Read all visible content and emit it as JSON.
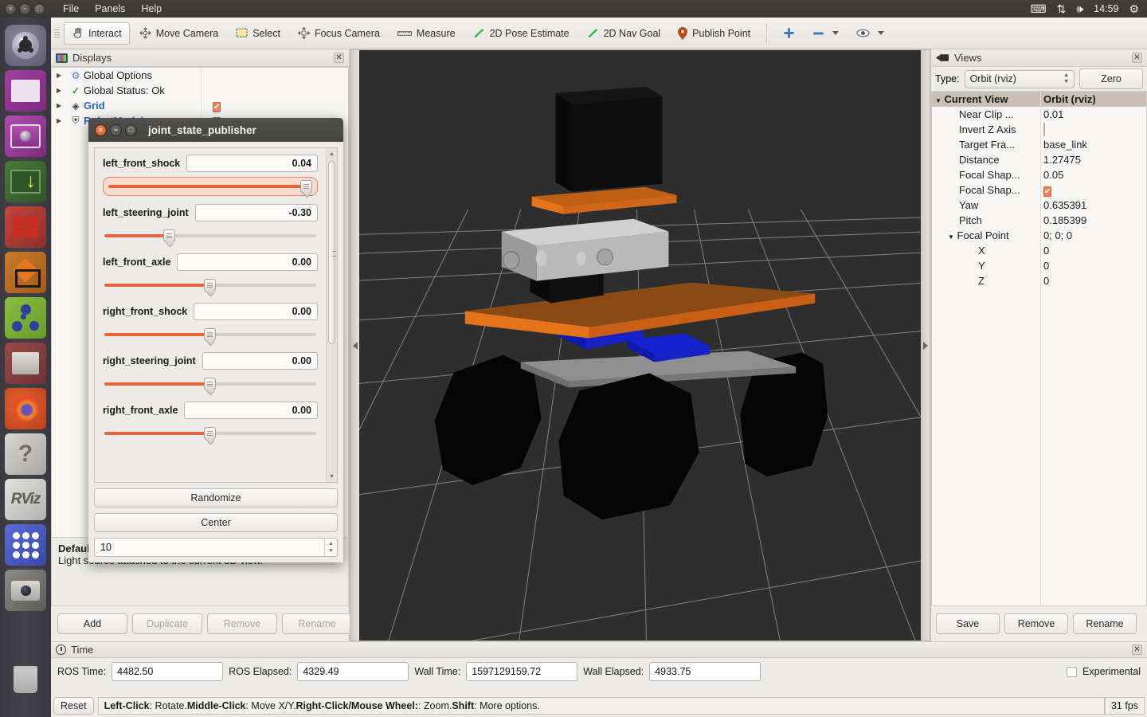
{
  "desktop": {
    "menu": [
      "File",
      "Panels",
      "Help"
    ],
    "window_buttons": [
      "close",
      "minimize",
      "maximize"
    ],
    "tray": {
      "icons": [
        "keyboard-icon",
        "network-updown-icon",
        "volume-icon",
        "power-gear-icon"
      ],
      "clock": "14:59"
    }
  },
  "launcher": {
    "items": [
      {
        "name": "ubuntu-dash",
        "label": "Ubuntu"
      },
      {
        "name": "files",
        "label": "Files"
      },
      {
        "name": "amplifier",
        "label": "Amplifier"
      },
      {
        "name": "terminator",
        "label": "Terminator"
      },
      {
        "name": "red-app",
        "label": "Red App"
      },
      {
        "name": "gazebo",
        "label": "Gazebo"
      },
      {
        "name": "rqt-graph",
        "label": "rqt graph"
      },
      {
        "name": "file-cabinet",
        "label": "File Cabinet"
      },
      {
        "name": "firefox",
        "label": "Firefox"
      },
      {
        "name": "help",
        "label": "Help"
      },
      {
        "name": "rviz",
        "label": "RViz"
      },
      {
        "name": "show-applications",
        "label": "Show Applications"
      },
      {
        "name": "camera",
        "label": "Camera"
      },
      {
        "name": "trash",
        "label": "Trash"
      }
    ]
  },
  "toolbar": {
    "tools": [
      {
        "label": "Interact",
        "icon": "hand-cursor-icon",
        "active": true
      },
      {
        "label": "Move Camera",
        "icon": "move-camera-icon",
        "active": false
      },
      {
        "label": "Select",
        "icon": "select-rect-icon",
        "active": false
      },
      {
        "label": "Focus Camera",
        "icon": "focus-camera-icon",
        "active": false
      },
      {
        "label": "Measure",
        "icon": "ruler-icon",
        "active": false
      },
      {
        "label": "2D Pose Estimate",
        "icon": "pose-arrow-icon",
        "active": false
      },
      {
        "label": "2D Nav Goal",
        "icon": "nav-goal-arrow-icon",
        "active": false
      },
      {
        "label": "Publish Point",
        "icon": "map-pin-icon",
        "active": false
      }
    ],
    "extra_icons": [
      "plus-icon",
      "minus-icon",
      "chevron-down-icon",
      "eye-icon",
      "chevron-down-icon"
    ]
  },
  "displays": {
    "title": "Displays",
    "title_icon": "monitor-icon",
    "close_icon": "close-icon",
    "tree": [
      {
        "label": "Global Options",
        "icon": "gear-icon",
        "expandable": true,
        "value": "",
        "link": false,
        "checkbox": null
      },
      {
        "label": "Global Status: Ok",
        "icon": "check-icon",
        "expandable": true,
        "value": "",
        "link": false,
        "checkbox": null
      },
      {
        "label": "Grid",
        "icon": "grid-icon",
        "expandable": true,
        "value": "",
        "link": true,
        "checkbox": "checked"
      },
      {
        "label": "RobotModel",
        "icon": "robot-icon",
        "expandable": true,
        "value": "",
        "link": true,
        "checkbox": "checked"
      }
    ],
    "description": {
      "title": "Default Light",
      "text": "Light source attached to the current 3D view."
    },
    "buttons": [
      {
        "label": "Add",
        "enabled": true
      },
      {
        "label": "Duplicate",
        "enabled": false
      },
      {
        "label": "Remove",
        "enabled": false
      },
      {
        "label": "Rename",
        "enabled": false
      }
    ]
  },
  "views": {
    "title": "Views",
    "title_icon": "camera-view-icon",
    "close_icon": "close-icon",
    "type_label": "Type:",
    "type_value": "Orbit (rviz)",
    "zero_button": "Zero",
    "header": {
      "key": "Current View",
      "value": "Orbit (rviz)"
    },
    "rows": [
      {
        "key": "Near Clip ...",
        "value": "0.01",
        "indent": 1,
        "type": "text"
      },
      {
        "key": "Invert Z Axis",
        "value": "",
        "indent": 1,
        "type": "checkbox-off"
      },
      {
        "key": "Target Fra...",
        "value": "base_link",
        "indent": 1,
        "type": "text"
      },
      {
        "key": "Distance",
        "value": "1.27475",
        "indent": 1,
        "type": "text"
      },
      {
        "key": "Focal Shap...",
        "value": "0.05",
        "indent": 1,
        "type": "text"
      },
      {
        "key": "Focal Shap...",
        "value": "",
        "indent": 1,
        "type": "checkbox-on"
      },
      {
        "key": "Yaw",
        "value": "0.635391",
        "indent": 1,
        "type": "text"
      },
      {
        "key": "Pitch",
        "value": "0.185399",
        "indent": 1,
        "type": "text"
      },
      {
        "key": "Focal Point",
        "value": "0; 0; 0",
        "indent": 1,
        "type": "expanded"
      },
      {
        "key": "X",
        "value": "0",
        "indent": 2,
        "type": "text"
      },
      {
        "key": "Y",
        "value": "0",
        "indent": 2,
        "type": "text"
      },
      {
        "key": "Z",
        "value": "0",
        "indent": 2,
        "type": "text"
      }
    ],
    "buttons": [
      {
        "label": "Save"
      },
      {
        "label": "Remove"
      },
      {
        "label": "Rename"
      }
    ]
  },
  "time_panel": {
    "title": "Time",
    "title_icon": "clock-icon",
    "close_icon": "close-icon",
    "fields": [
      {
        "label": "ROS Time:",
        "value": "4482.50"
      },
      {
        "label": "ROS Elapsed:",
        "value": "4329.49"
      },
      {
        "label": "Wall Time:",
        "value": "1597129159.72"
      },
      {
        "label": "Wall Elapsed:",
        "value": "4933.75"
      }
    ],
    "experimental_label": "Experimental",
    "experimental_checked": false
  },
  "statusbar": {
    "reset_button": "Reset",
    "hint_parts": [
      {
        "text": "Left-Click",
        "bold": true
      },
      {
        "text": ": Rotate.  ",
        "bold": false
      },
      {
        "text": "Middle-Click",
        "bold": true
      },
      {
        "text": ": Move X/Y.  ",
        "bold": false
      },
      {
        "text": "Right-Click/Mouse Wheel:",
        "bold": true
      },
      {
        "text": ": Zoom.  ",
        "bold": false
      },
      {
        "text": "Shift",
        "bold": true
      },
      {
        "text": ": More options.",
        "bold": false
      }
    ],
    "fps": "31 fps"
  },
  "joint_state_publisher": {
    "title": "joint_state_publisher",
    "window_buttons": [
      "close",
      "minimize",
      "maximize"
    ],
    "joints": [
      {
        "name": "left_front_shock",
        "value": "0.04",
        "slider_pct": 98,
        "focused": true
      },
      {
        "name": "left_steering_joint",
        "value": "-0.30",
        "slider_pct": 31,
        "focused": false
      },
      {
        "name": "left_front_axle",
        "value": "0.00",
        "slider_pct": 50,
        "focused": false
      },
      {
        "name": "right_front_shock",
        "value": "0.00",
        "slider_pct": 50,
        "focused": false
      },
      {
        "name": "right_steering_joint",
        "value": "0.00",
        "slider_pct": 50,
        "focused": false
      },
      {
        "name": "right_front_axle",
        "value": "0.00",
        "slider_pct": 50,
        "focused": false
      }
    ],
    "randomize_button": "Randomize",
    "center_button": "Center",
    "rate_value": "10"
  },
  "viewport": {
    "background_color": "#2e2e2e",
    "grid_color": "#9b9b9b",
    "robot_colors": {
      "chassis_orange": "#e5731a",
      "chassis_dark_orange": "#8a4a14",
      "wheel_black": "#050505",
      "sensor_grey": "#b8b8b8",
      "plate_grey": "#9a9a9a",
      "blue_part": "#1520d0"
    }
  }
}
